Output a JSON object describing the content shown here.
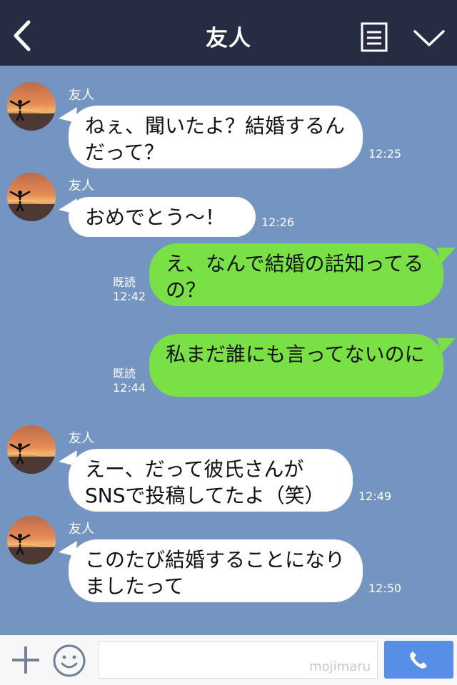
{
  "header": {
    "title": "友人",
    "icons": [
      "chevron-left-icon",
      "menu-icon",
      "chevron-down-icon"
    ]
  },
  "messages": [
    {
      "sender": "友人",
      "text": "ねぇ、聞いたよ？結婚するんだって？",
      "time": "12:25"
    },
    {
      "sender": "友人",
      "text": "おめでとう～！",
      "time": "12:26"
    },
    {
      "read": "既読",
      "text": "え、なんで結婚の話知ってるの？",
      "time": "12:42"
    },
    {
      "read": "既読",
      "text": "私まだ誰にも言ってないのに",
      "time": "12:44"
    },
    {
      "sender": "友人",
      "text": "えー、だって彼氏さんがSNSで投稿してたよ（笑）",
      "time": "12:49"
    },
    {
      "sender": "友人",
      "text": "このたび結婚することになりましたって",
      "time": "12:50"
    }
  ],
  "footer": {
    "watermark": "mojimaru",
    "icons": [
      "plus-icon",
      "smile-icon",
      "phone-icon"
    ]
  },
  "colors": {
    "header_bg": "#262c41",
    "chat_bg": "#7495c1",
    "incoming_bubble": "#ffffff",
    "outgoing_bubble": "#79e045",
    "send_button": "#588fe6"
  }
}
